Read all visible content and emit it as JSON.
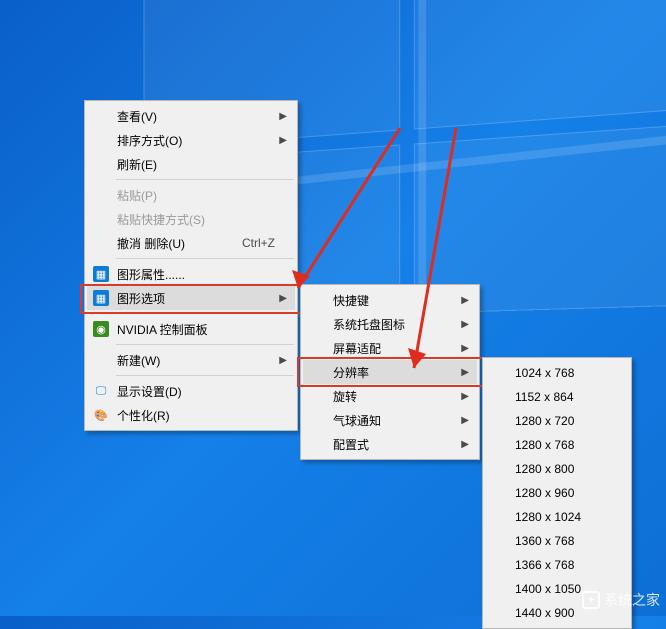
{
  "menu1": {
    "view": "查看(V)",
    "sort": "排序方式(O)",
    "refresh": "刷新(E)",
    "paste": "粘贴(P)",
    "paste_shortcut": "粘贴快捷方式(S)",
    "undo_delete": "撤消 删除(U)",
    "undo_shortcut": "Ctrl+Z",
    "gfx_props": "图形属性......",
    "gfx_options": "图形选项",
    "nvidia": "NVIDIA 控制面板",
    "new": "新建(W)",
    "display": "显示设置(D)",
    "personalize": "个性化(R)"
  },
  "menu2": {
    "hotkeys": "快捷键",
    "tray": "系统托盘图标",
    "fit": "屏幕适配",
    "resolution": "分辨率",
    "rotate": "旋转",
    "balloon": "气球通知",
    "profile": "配置式"
  },
  "menu3": {
    "r0": "1024 x 768",
    "r1": "1152 x 864",
    "r2": "1280 x 720",
    "r3": "1280 x 768",
    "r4": "1280 x 800",
    "r5": "1280 x 960",
    "r6": "1280 x 1024",
    "r7": "1360 x 768",
    "r8": "1366 x 768",
    "r9": "1400 x 1050",
    "r10": "1440 x 900"
  },
  "watermark": "系统之家"
}
